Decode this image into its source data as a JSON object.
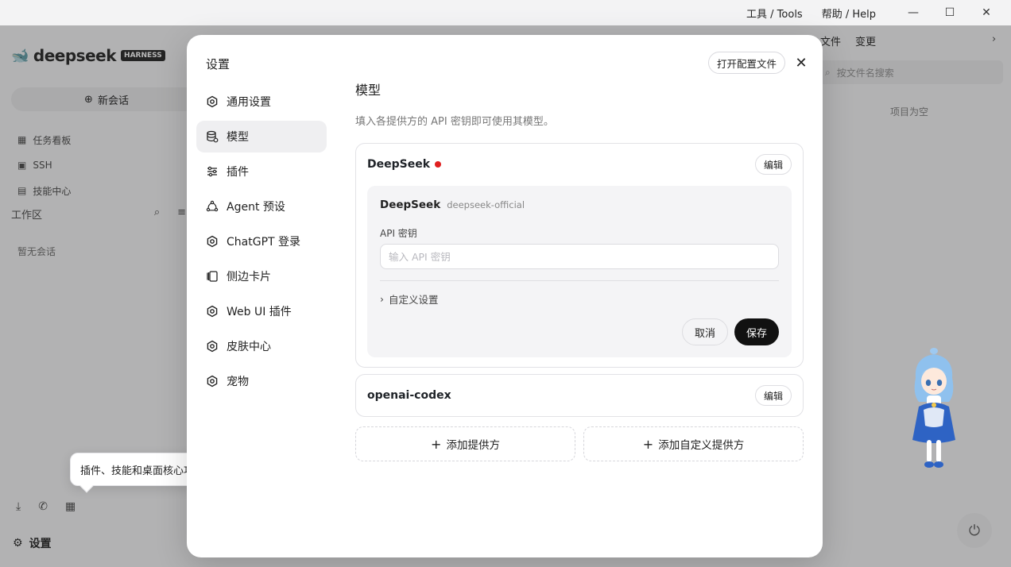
{
  "titlebar": {
    "tools": "工具 / Tools",
    "help": "帮助 / Help",
    "minimize": "—",
    "maximize": "☐",
    "close": "✕"
  },
  "background": {
    "logo": "deepseek",
    "logo_badge": "HARNESS",
    "new_chat": "新会话",
    "nav": [
      "任务看板",
      "SSH",
      "技能中心"
    ],
    "workspace": "工作区",
    "empty": "暂无会话",
    "settings": "设置",
    "right_tabs": [
      "文件",
      "变更"
    ],
    "search_placeholder": "按文件名搜索",
    "project_empty": "项目为空"
  },
  "tooltip": {
    "text": "插件、技能和桌面核心功能在这里",
    "close": "×"
  },
  "modal": {
    "title": "设置",
    "open_config": "打开配置文件",
    "close": "✕",
    "sidebar": [
      {
        "label": "通用设置",
        "icon": "gear-icon",
        "active": false
      },
      {
        "label": "模型",
        "icon": "database-icon",
        "active": true
      },
      {
        "label": "插件",
        "icon": "sliders-icon",
        "active": false
      },
      {
        "label": "Agent 预设",
        "icon": "agent-icon",
        "active": false
      },
      {
        "label": "ChatGPT 登录",
        "icon": "gear-icon",
        "active": false
      },
      {
        "label": "侧边卡片",
        "icon": "cards-icon",
        "active": false
      },
      {
        "label": "Web UI 插件",
        "icon": "gear-icon",
        "active": false
      },
      {
        "label": "皮肤中心",
        "icon": "gear-icon",
        "active": false
      },
      {
        "label": "宠物",
        "icon": "gear-icon",
        "active": false
      }
    ],
    "content": {
      "heading": "模型",
      "description": "填入各提供方的 API 密钥即可使用其模型。",
      "providers": [
        {
          "name": "DeepSeek",
          "status_color": "#e02020",
          "edit": "编辑",
          "expanded": {
            "title": "DeepSeek",
            "id": "deepseek-official",
            "api_label": "API 密钥",
            "api_placeholder": "输入 API 密钥",
            "api_value": "",
            "custom": "自定义设置",
            "cancel": "取消",
            "save": "保存"
          }
        },
        {
          "name": "openai-codex",
          "edit": "编辑"
        }
      ],
      "add_provider": "添加提供方",
      "add_custom_provider": "添加自定义提供方"
    }
  },
  "colors": {
    "accent": "#111111",
    "status_dot": "#e02020",
    "active_bg": "#efeff1"
  }
}
